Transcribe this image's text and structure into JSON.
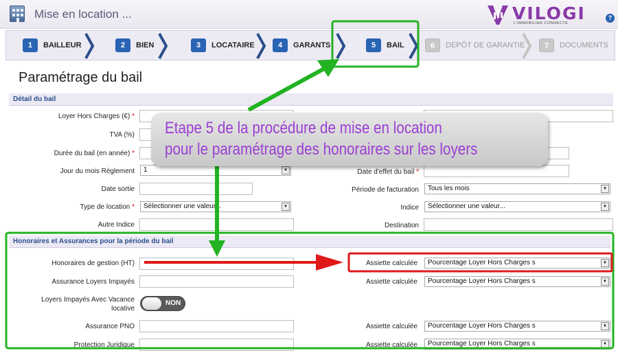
{
  "window": {
    "title": "Mise en location ..."
  },
  "logo": {
    "name": "VILOGI",
    "tagline": "L'IMMOBILIER CONNECTÉ"
  },
  "help": {
    "icon": "help-icon",
    "label": "?"
  },
  "steps": [
    {
      "num": "1",
      "label": "BAILLEUR",
      "state": "done"
    },
    {
      "num": "2",
      "label": "BIEN",
      "state": "done"
    },
    {
      "num": "3",
      "label": "LOCATAIRE",
      "state": "done"
    },
    {
      "num": "4",
      "label": "GARANTS",
      "state": "done"
    },
    {
      "num": "5",
      "label": "BAIL",
      "state": "current"
    },
    {
      "num": "6",
      "label": "DEPÔT DE GARANTIE",
      "state": "disabled"
    },
    {
      "num": "7",
      "label": "DOCUMENTS",
      "state": "disabled"
    }
  ],
  "page": {
    "title": "Paramétrage du bail"
  },
  "sections": {
    "detail": "Détail du bail",
    "honoraires": "Honoraires et Assurances pour la période du bail"
  },
  "form": {
    "loyer_hc": {
      "label": "Loyer Hors Charges (€)",
      "required": "*",
      "value": ""
    },
    "tva": {
      "label": "TVA (%)",
      "value": ""
    },
    "duree": {
      "label": "Durée du bail (en année)",
      "required": "*",
      "value": ""
    },
    "jour_reglement": {
      "label": "Jour du mois Règlement",
      "value": "1"
    },
    "date_sortie": {
      "label": "Date sortie",
      "value": ""
    },
    "type_location": {
      "label": "Type de location",
      "required": "*",
      "value": "Sélectionner une valeur..."
    },
    "autre_indice": {
      "label": "Autre Indice",
      "value": ""
    },
    "date_effet": {
      "label": "Date d'effet du bail",
      "required": "*",
      "value": ""
    },
    "periode_facturation": {
      "label": "Période de facturation",
      "value": "Tous les mois"
    },
    "indice": {
      "label": "Indice",
      "value": "Sélectionner une valeur..."
    },
    "destination": {
      "label": "Destination",
      "value": ""
    },
    "honoraires_gestion": {
      "label": "Honoraires de gestion (HT)",
      "value": ""
    },
    "assurance_loyers": {
      "label": "Assurance Loyers Impayés",
      "value": ""
    },
    "loyers_vacance": {
      "label_line1": "Loyers Impayés Avec Vacance",
      "label_line2": "locative",
      "toggle": "NON"
    },
    "assurance_pno": {
      "label": "Assurance PNO",
      "value": ""
    },
    "protection_juridique": {
      "label": "Protection Juridique",
      "value": ""
    },
    "assiette_label": "Assiette calculée",
    "assiette_value": "Pourcentage Loyer Hors Charges s"
  },
  "annotation": {
    "line1": "Etape 5 de la procédure de mise en location",
    "line2": "pour le paramétrage des honoraires sur les loyers"
  },
  "colors": {
    "step_number": "#2a64b4",
    "section_header_text": "#2b4f8c",
    "annotation_text": "#9b3fd4",
    "highlight_green": "#22b322",
    "highlight_red": "#e01818"
  }
}
